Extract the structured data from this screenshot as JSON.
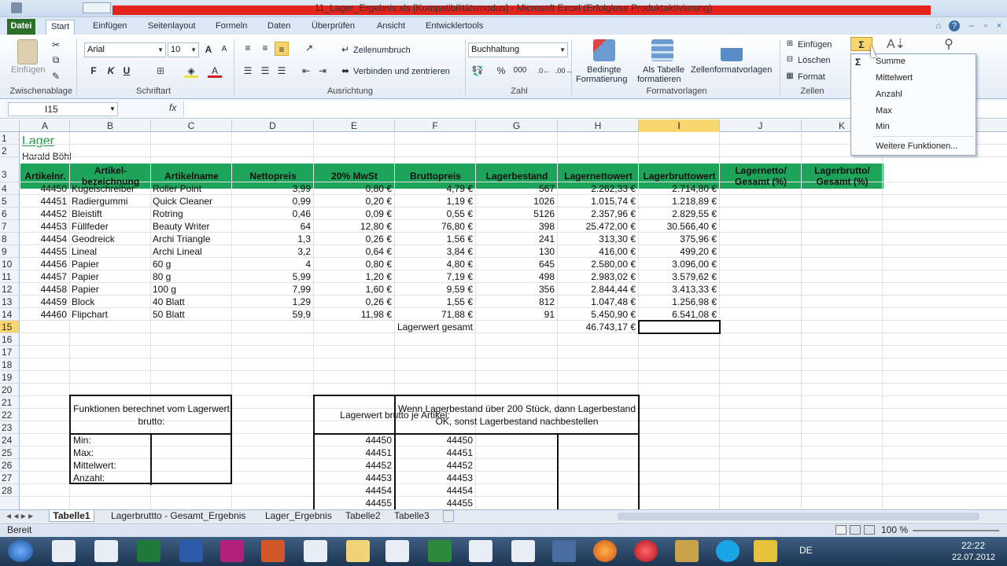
{
  "window": {
    "title": "11_Lager_Ergebnis.xls [Kompatibilitätsmodus] - Microsoft Excel (Erfolglose Produktaktivierung)"
  },
  "tabs": [
    "Datei",
    "Start",
    "Einfügen",
    "Seitenlayout",
    "Formeln",
    "Daten",
    "Überprüfen",
    "Ansicht",
    "Entwicklertools"
  ],
  "ribbon": {
    "clipboard": {
      "paste_label": "Einfügen",
      "group": "Zwischenablage"
    },
    "font": {
      "name": "Arial",
      "size": "10",
      "bold": "F",
      "italic": "K",
      "underline": "U",
      "group": "Schriftart"
    },
    "alignment": {
      "wrap": "Zeilenumbruch",
      "merge": "Verbinden und zentrieren",
      "group": "Ausrichtung"
    },
    "number": {
      "format": "Buchhaltung",
      "percent": "%",
      "thousands": "000",
      "group": "Zahl"
    },
    "styles": {
      "conditional": "Bedingte",
      "conditional2": "Formatierung",
      "as_table": "Als Tabelle",
      "as_table2": "formatieren",
      "cell_styles": "Zellenformatvorlagen",
      "group": "Formatvorlagen"
    },
    "cells": {
      "insert": "Einfügen",
      "delete": "Löschen",
      "format": "Format",
      "group": "Zellen"
    },
    "editing": {
      "sum_symbol": "Σ"
    }
  },
  "formula_bar": {
    "name_box": "I15",
    "fx": "fx",
    "content": ""
  },
  "columns": [
    {
      "id": "A",
      "w": 63
    },
    {
      "id": "B",
      "w": 103
    },
    {
      "id": "C",
      "w": 103
    },
    {
      "id": "D",
      "w": 104
    },
    {
      "id": "E",
      "w": 103
    },
    {
      "id": "F",
      "w": 103
    },
    {
      "id": "G",
      "w": 104
    },
    {
      "id": "H",
      "w": 103
    },
    {
      "id": "I",
      "w": 103
    },
    {
      "id": "J",
      "w": 104
    },
    {
      "id": "K",
      "w": 103
    }
  ],
  "rows": [
    "1",
    "2",
    "3",
    "4",
    "5",
    "6",
    "7",
    "8",
    "9",
    "10",
    "11",
    "12",
    "13",
    "14",
    "15",
    "16",
    "17",
    "18",
    "19",
    "20",
    "21",
    "22",
    "23",
    "24",
    "25",
    "26",
    "27",
    "28"
  ],
  "sheet": {
    "title": "Lager",
    "author": "Harald Böhl",
    "headers": [
      "Artikelnr.",
      "Artikel-\nbezeichnung",
      "Artikelname",
      "Nettopreis",
      "20% MwSt",
      "Bruttopreis",
      "Lagerbestand",
      "Lagernettowert",
      "Lagerbruttowert",
      "Lagernetto/\nGesamt (%)",
      "Lagerbrutto/\nGesamt (%)"
    ],
    "data": [
      [
        "44450",
        "Kugelschreiber",
        "Roller Point",
        "3,99",
        "0,80 €",
        "4,79 €",
        "567",
        "2.262,33 €",
        "2.714,80 €"
      ],
      [
        "44451",
        "Radiergummi",
        "Quick Cleaner",
        "0,99",
        "0,20 €",
        "1,19 €",
        "1026",
        "1.015,74 €",
        "1.218,89 €"
      ],
      [
        "44452",
        "Bleistift",
        "Rotring",
        "0,46",
        "0,09 €",
        "0,55 €",
        "5126",
        "2.357,96 €",
        "2.829,55 €"
      ],
      [
        "44453",
        "Füllfeder",
        "Beauty Writer",
        "64",
        "12,80 €",
        "76,80 €",
        "398",
        "25.472,00 €",
        "30.566,40 €"
      ],
      [
        "44454",
        "Geodreick",
        "Archi Triangle",
        "1,3",
        "0,26 €",
        "1,56 €",
        "241",
        "313,30 €",
        "375,96 €"
      ],
      [
        "44455",
        "Lineal",
        "Archi Lineal",
        "3,2",
        "0,64 €",
        "3,84 €",
        "130",
        "416,00 €",
        "499,20 €"
      ],
      [
        "44456",
        "Papier",
        "60 g",
        "4",
        "0,80 €",
        "4,80 €",
        "645",
        "2.580,00 €",
        "3.096,00 €"
      ],
      [
        "44457",
        "Papier",
        "80 g",
        "5,99",
        "1,20 €",
        "7,19 €",
        "498",
        "2.983,02 €",
        "3.579,62 €"
      ],
      [
        "44458",
        "Papier",
        "100 g",
        "7,99",
        "1,60 €",
        "9,59 €",
        "356",
        "2.844,44 €",
        "3.413,33 €"
      ],
      [
        "44459",
        "Block",
        "40 Blatt",
        "1,29",
        "0,26 €",
        "1,55 €",
        "812",
        "1.047,48 €",
        "1.256,98 €"
      ],
      [
        "44460",
        "Flipchart",
        "50 Blatt",
        "59,9",
        "11,98 €",
        "71,88 €",
        "91",
        "5.450,90 €",
        "6.541,08 €"
      ]
    ],
    "total_label": "Lagerwert gesamt",
    "total_value": "46.743,17 €",
    "func_box": {
      "title": "Funktionen berechnet vom Lagerwert brutto:",
      "rows": [
        "Min:",
        "Max:",
        "Mittelwert:",
        "Anzahl:"
      ]
    },
    "brutto_box": {
      "title": "Lagerwert brutto je Artikel:",
      "ids": [
        "44450",
        "44451",
        "44452",
        "44453",
        "44454",
        "44455"
      ]
    },
    "cond_box": {
      "title": "Wenn Lagerbestand über 200 Stück, dann Lagerbestand OK, sonst Lagerbestand nachbestellen",
      "ids": [
        "44450",
        "44451",
        "44452",
        "44453",
        "44454",
        "44455"
      ]
    }
  },
  "sheet_tabs": [
    "Tabelle1",
    "Lagerbruttto - Gesamt_Ergebnis",
    "Lager_Ergebnis",
    "Tabelle2",
    "Tabelle3"
  ],
  "status": {
    "ready": "Bereit",
    "zoom": "100 %"
  },
  "dropdown": {
    "items": [
      "Summe",
      "Mittelwert",
      "Anzahl",
      "Max",
      "Min",
      "Weitere Funktionen..."
    ]
  },
  "taskbar": {
    "lang": "DE",
    "time": "22:22",
    "date": "22.07.2012"
  },
  "colors": {
    "header_green": "#1ea45a",
    "title_green": "#1e9a48",
    "selection": "#f8d66e",
    "title_red": "#e4231d"
  }
}
